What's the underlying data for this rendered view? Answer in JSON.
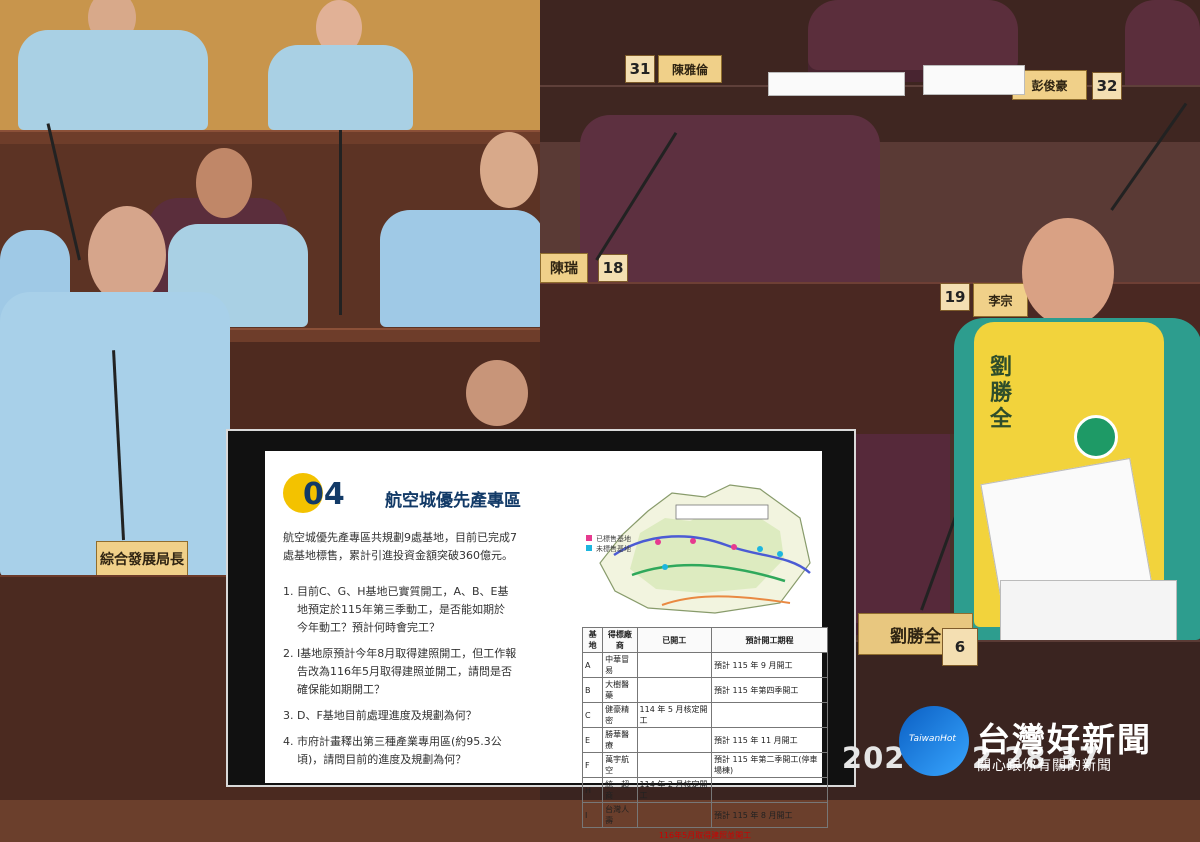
{
  "image": {
    "left_nameplate": "綜合發展局長",
    "right_nameplate": "劉勝全",
    "seats": [
      "31",
      "32",
      "18",
      "19",
      "6"
    ],
    "seat_names": [
      "陳雅倫",
      "彭俊豪",
      "陳瑞",
      "李宗"
    ],
    "vest_text": "劉勝全"
  },
  "slide": {
    "section_number": "04",
    "title": "航空城優先產專區",
    "intro_1": "航空城優先產專區共規劃9處基地，目前已完成7",
    "intro_2": "處基地標售，累計引進投資金額突破360億元。",
    "q1_1": "1. 目前C、G、H基地已實質開工，A、B、E基",
    "q1_2": "地預定於115年第三季動工，是否能如期於",
    "q1_3": "今年動工？預計何時會完工？",
    "q2_1": "2. I基地原預計今年8月取得建照開工，但工作報",
    "q2_2": "告改為116年5月取得建照並開工，請問是否",
    "q2_3": "確保能如期開工？",
    "q3": "3. D、F基地目前處理進度及規劃為何？",
    "q4_1": "4. 市府計畫釋出第三種產業專用區(約95.3公",
    "q4_2": "頃)，請問目前的進度及規劃為何？",
    "table_headers": [
      "基地",
      "得標廠商",
      "已開工",
      "預計開工期程"
    ],
    "table_rows": [
      [
        "A",
        "中華冒易",
        "",
        "預計 115 年 9 月開工"
      ],
      [
        "B",
        "大樹醫藥",
        "",
        "預計 115 年第四季開工"
      ],
      [
        "C",
        "健豪精密",
        "114 年 5 月核定開工",
        ""
      ],
      [
        "E",
        "勝華醫療",
        "",
        "預計 115 年 11 月開工"
      ],
      [
        "F",
        "萬宇航空",
        "",
        "預計 115 年第二季開工(停車場棟)"
      ],
      [
        "H",
        "統一超商",
        "114 年 2 月核定開工",
        ""
      ],
      [
        "I",
        "台灣人壽",
        "",
        "預計 115 年 8 月開工"
      ]
    ],
    "table_note": "116年5月取得建照並開工",
    "map_legend": [
      "已標售基地",
      "未標售基地"
    ]
  },
  "overlay": {
    "timestamp": "2026-0   2   28  37",
    "logo_en": "TaiwanHot",
    "logo_main": "台灣好新聞",
    "logo_sub": "關心跟你有關的新聞"
  },
  "colors": {
    "yellow_vest": "#f2d33c",
    "shirt_blue": "#9fc9e6",
    "logo_blue": "#1f7ee8"
  }
}
